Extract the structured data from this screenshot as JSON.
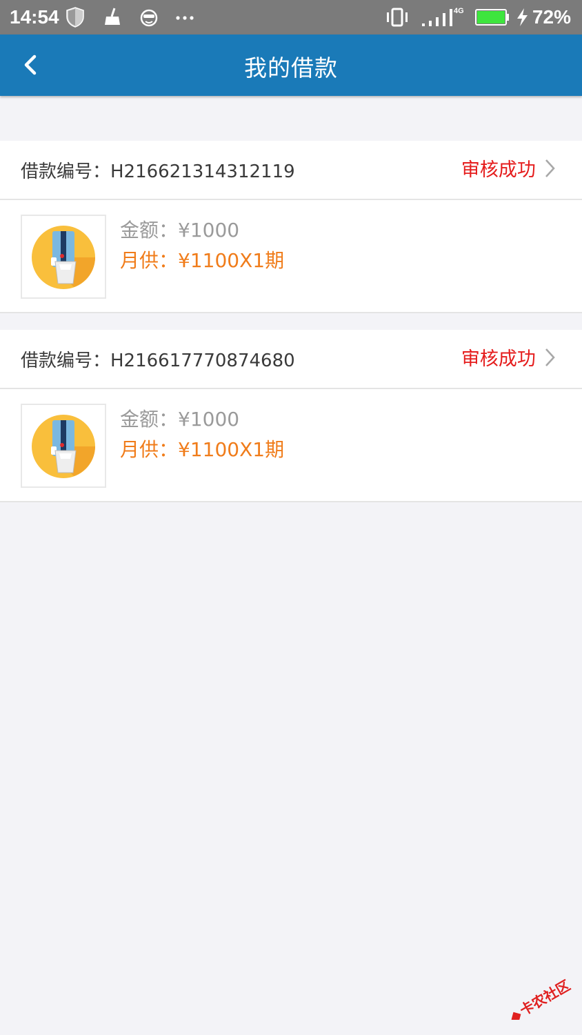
{
  "status_bar": {
    "time": "14:54",
    "network": "4G",
    "battery": "72%",
    "battery_color": "#3ee53e"
  },
  "nav": {
    "title": "我的借款",
    "back_icon": "chevron-left-icon"
  },
  "loans": [
    {
      "loan_no_label": "借款编号：H216621314312119",
      "status": "审核成功",
      "amount": "金额：¥1000",
      "monthly": "月供：¥1100X1期"
    },
    {
      "loan_no_label": "借款编号：H216617770874680",
      "status": "审核成功",
      "amount": "金额：¥1000",
      "monthly": "月供：¥1100X1期"
    }
  ],
  "colors": {
    "navbar": "#1a7ab8",
    "status_ok": "#e51c1c",
    "monthly": "#f07c1a",
    "amount": "#9a9a9a"
  },
  "watermark": "卡农社区"
}
